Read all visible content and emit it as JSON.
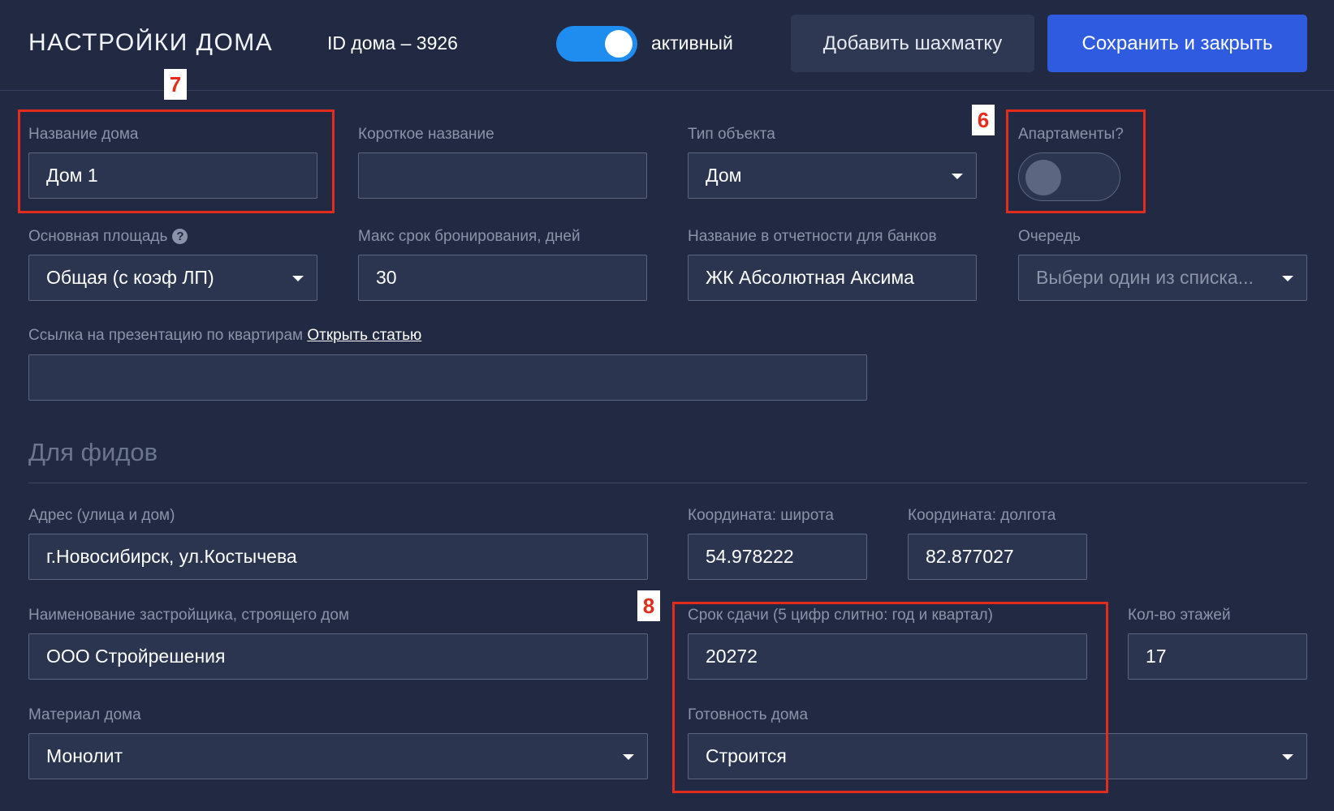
{
  "header": {
    "title": "НАСТРОЙКИ ДОМА",
    "house_id": "ID дома – 3926",
    "active_label": "активный",
    "active_on": true,
    "add_chess_button": "Добавить шахматку",
    "save_close_button": "Сохранить и закрыть"
  },
  "form": {
    "house_name": {
      "label": "Название дома",
      "value": "Дом 1"
    },
    "short_name": {
      "label": "Короткое название",
      "value": ""
    },
    "object_type": {
      "label": "Тип объекта",
      "value": "Дом"
    },
    "apartments": {
      "label": "Апартаменты?",
      "on": false
    },
    "main_area": {
      "label": "Основная площадь",
      "help_icon": "?",
      "value": "Общая (с коэф ЛП)"
    },
    "max_booking": {
      "label": "Макс срок бронирования, дней",
      "value": "30"
    },
    "bank_report_name": {
      "label": "Название в отчетности для банков",
      "value": "ЖК Абсолютная Аксима"
    },
    "queue": {
      "label": "Очередь",
      "placeholder": "Выбери один из списка..."
    },
    "presentation_link": {
      "label": "Ссылка на презентацию по квартирам",
      "link_text": "Открыть статью",
      "value": ""
    }
  },
  "feeds": {
    "section_title": "Для фидов",
    "address": {
      "label": "Адрес (улица и дом)",
      "value": "г.Новосибирск, ул.Костычева"
    },
    "latitude": {
      "label": "Координата: широта",
      "value": "54.978222"
    },
    "longitude": {
      "label": "Координата: долгота",
      "value": "82.877027"
    },
    "developer": {
      "label": "Наименование застройщика, строящего дом",
      "value": "ООО Стройрешения"
    },
    "deadline": {
      "label": "Срок сдачи (5 цифр слитно: год и квартал)",
      "value": "20272"
    },
    "floors": {
      "label": "Кол-во этажей",
      "value": "17"
    },
    "material": {
      "label": "Материал дома",
      "value": "Монолит"
    },
    "readiness": {
      "label": "Готовность дома",
      "value": "Строится"
    }
  },
  "annotations": {
    "a7": "7",
    "a6": "6",
    "a8": "8"
  },
  "colors": {
    "background": "#222a43",
    "primary": "#2f5be0",
    "toggle_on": "#1f8cf0",
    "annotation": "#e32c1e"
  }
}
